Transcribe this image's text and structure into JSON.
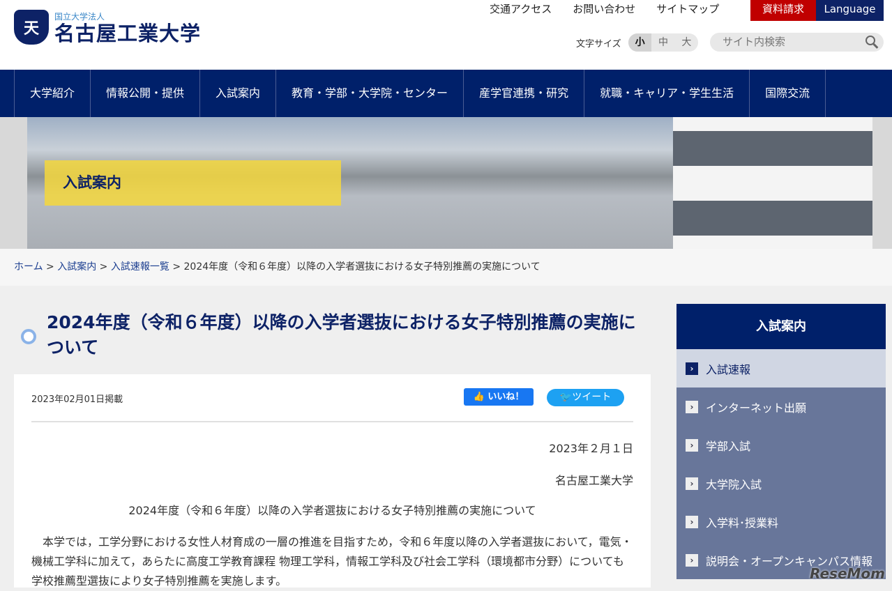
{
  "header": {
    "logo_sub": "国立大学法人",
    "logo_main": "名古屋工業大学",
    "links": [
      "交通アクセス",
      "お問い合わせ",
      "サイトマップ"
    ],
    "request": "資料請求",
    "language": "Language",
    "font_size_label": "文字サイズ",
    "font_sizes": [
      "小",
      "中",
      "大"
    ],
    "search_placeholder": "サイト内検索"
  },
  "nav": [
    "大学紹介",
    "情報公開・提供",
    "入試案内",
    "教育・学部・大学院・センター",
    "産学官連携・研究",
    "就職・キャリア・学生生活",
    "国際交流"
  ],
  "hero": {
    "title": "入試案内"
  },
  "breadcrumb": {
    "home": "ホーム",
    "l1": "入試案内",
    "l2": "入試速報一覧",
    "current": "2024年度（令和６年度）以降の入学者選抜における女子特別推薦の実施について"
  },
  "article": {
    "title": "2024年度（令和６年度）以降の入学者選抜における女子特別推薦の実施について",
    "posted": "2023年02月01日掲載",
    "like": "いいね！",
    "tweet": "ツイート",
    "date": "2023年２月１日",
    "org": "名古屋工業大学",
    "heading": "2024年度（令和６年度）以降の入学者選抜における女子特別推薦の実施について",
    "body": "本学では，工学分野における女性人材育成の一層の推進を目指すため，令和６年度以降の入学者選抜において，電気・機械工学科に加えて，あらたに高度工学教育課程 物理工学科，情報工学科及び社会工学科（環境都市分野）についても学校推薦型選抜により女子特別推薦を実施します。"
  },
  "sidebar": {
    "title": "入試案内",
    "items": [
      "入試速報",
      "インターネット出願",
      "学部入試",
      "大学院入試",
      "入学料･授業料",
      "説明会・オープンキャンパス情報"
    ]
  },
  "watermark": "ReseMom"
}
